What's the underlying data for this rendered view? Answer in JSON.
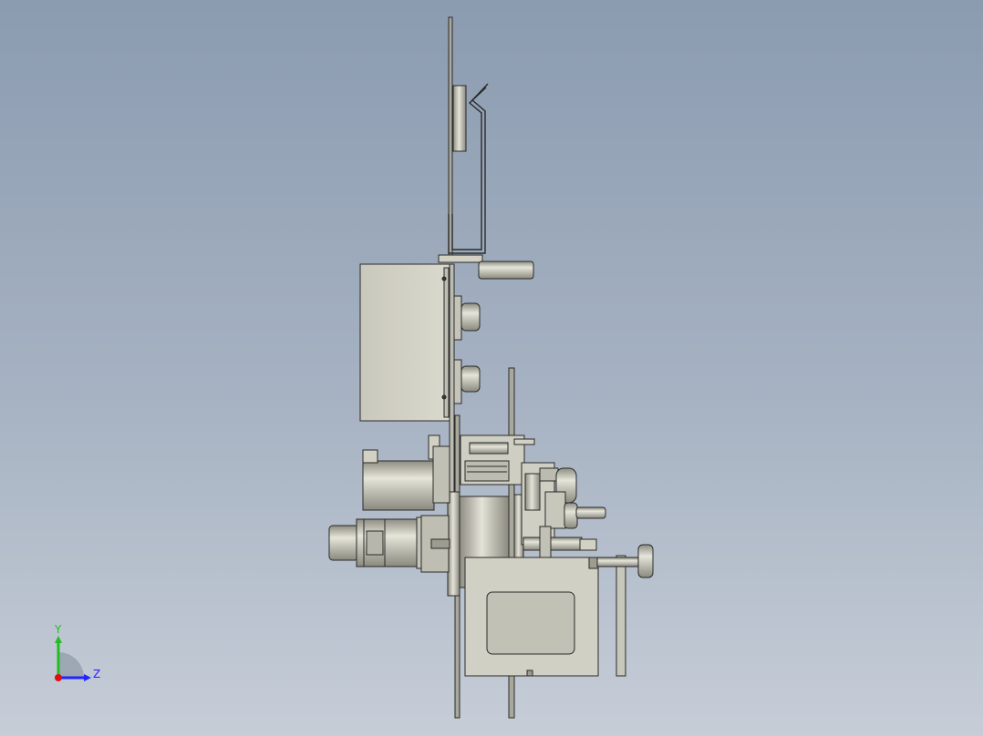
{
  "viewport": {
    "background_top": "#8b9bb0",
    "background_bottom": "#c6cdd7",
    "part_fill": "#d2d1c4",
    "part_fill_dark": "#9d9c90",
    "edge_color": "#2a2a2a"
  },
  "triad": {
    "y_label": "Y",
    "z_label": "Z",
    "y_color": "#1fbf1f",
    "z_color": "#2323ff",
    "x_color": "#e01010"
  }
}
